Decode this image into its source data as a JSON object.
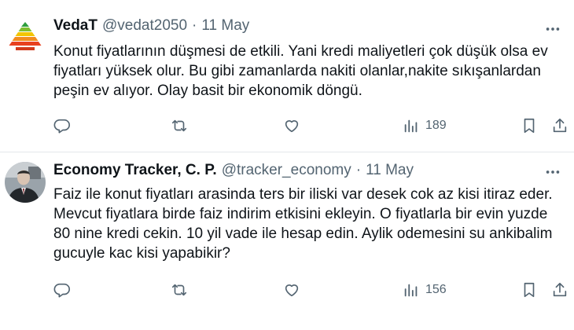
{
  "tweets": [
    {
      "name": "VedaT",
      "handle": "@vedat2050",
      "separator": "·",
      "date": "11 May",
      "lines": [
        "Konut fiyatlarının düşmesi de etkili. Yani kredi maliyetleri çok düşük olsa ev",
        "fiyatları yüksek olur. Bu gibi zamanlarda nakiti olanlar,nakite sıkışanlardan",
        "peşin ev alıyor. Olay basit bir ekonomik döngü."
      ],
      "views": "189",
      "avatar_icon": "pyramid-logo-icon"
    },
    {
      "name": "Economy Tracker, C. P.",
      "handle": "@tracker_economy",
      "separator": "·",
      "date": "11 May",
      "lines": [
        "Faiz ile konut fiyatları arasinda ters bir iliski var desek cok az kisi itiraz eder.",
        "Mevcut fiyatlara birde faiz indirim etkisini ekleyin. O fiyatlarla bir evin yuzde",
        "80 nine kredi cekin. 10 yil vade ile hesap edin. Aylik odemesini su ankibalim",
        "gucuyle kac kisi yapabikir?"
      ],
      "views": "156",
      "avatar_icon": "person-photo-icon"
    }
  ],
  "colors": {
    "text": "#0f1419",
    "secondary": "#536471",
    "divider": "#e3e7ea"
  }
}
